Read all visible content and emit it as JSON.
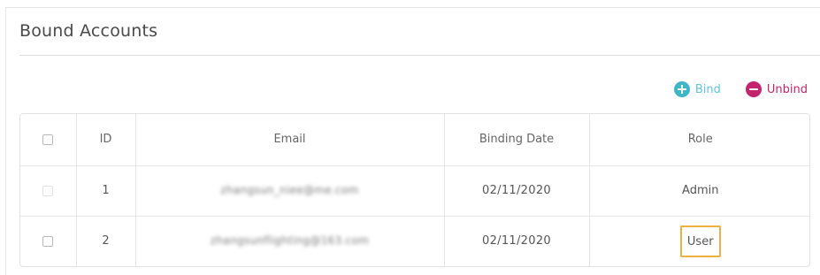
{
  "section": {
    "title": "Bound Accounts"
  },
  "toolbar": {
    "bind_label": "Bind",
    "unbind_label": "Unbind",
    "bind_color": "#3fb5c6",
    "unbind_color": "#c4246c"
  },
  "table": {
    "headers": {
      "id": "ID",
      "email": "Email",
      "binding_date": "Binding Date",
      "role": "Role"
    },
    "rows": [
      {
        "id": "1",
        "email": "zhangsun_niee@me.com",
        "binding_date": "02/11/2020",
        "role": "Admin"
      },
      {
        "id": "2",
        "email": "zhangsunflighting@163.com",
        "binding_date": "02/11/2020",
        "role": "User"
      }
    ]
  },
  "colors": {
    "highlight_border": "#f0b040"
  }
}
